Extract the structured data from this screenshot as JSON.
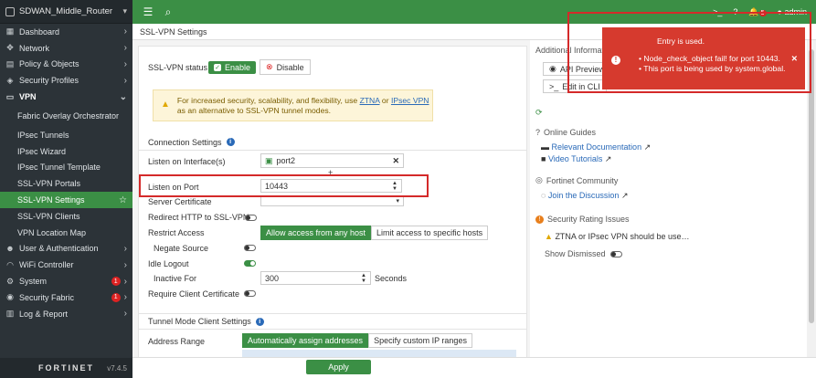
{
  "sidebar": {
    "device_name": "SDWAN_Middle_Router",
    "items": [
      {
        "label": "Dashboard",
        "icon": "dashboard-icon"
      },
      {
        "label": "Network",
        "icon": "network-icon"
      },
      {
        "label": "Policy & Objects",
        "icon": "policy-icon"
      },
      {
        "label": "Security Profiles",
        "icon": "security-profiles-icon"
      },
      {
        "label": "VPN",
        "icon": "vpn-icon"
      },
      {
        "label": "Fabric Overlay Orchestrator"
      },
      {
        "label": "IPsec Tunnels"
      },
      {
        "label": "IPsec Wizard"
      },
      {
        "label": "IPsec Tunnel Template"
      },
      {
        "label": "SSL-VPN Portals"
      },
      {
        "label": "SSL-VPN Settings"
      },
      {
        "label": "SSL-VPN Clients"
      },
      {
        "label": "VPN Location Map"
      },
      {
        "label": "User & Authentication",
        "icon": "user-icon"
      },
      {
        "label": "WiFi Controller",
        "icon": "wifi-icon"
      },
      {
        "label": "System",
        "icon": "gear-icon",
        "badge": "1"
      },
      {
        "label": "Security Fabric",
        "icon": "fabric-icon",
        "badge": "1"
      },
      {
        "label": "Log & Report",
        "icon": "log-icon"
      }
    ],
    "footer_logo": "FORTINET",
    "version": "v7.4.5"
  },
  "topbar": {
    "user": "admin",
    "alert_count": "5"
  },
  "breadcrumb": "SSL-VPN Settings",
  "main": {
    "status_label": "SSL-VPN status",
    "enable_label": "Enable",
    "disable_label": "Disable",
    "warning_pre": "For increased security, scalability, and flexibility, use ",
    "warning_link1": "ZTNA",
    "warning_or": " or ",
    "warning_link2": "IPsec VPN",
    "warning_post": "as an alternative to SSL-VPN tunnel modes.",
    "connection_settings": "Connection Settings",
    "listen_interface_label": "Listen on Interface(s)",
    "listen_interface_value": "port2",
    "listen_port_label": "Listen on Port",
    "listen_port_value": "10443",
    "server_cert_label": "Server Certificate",
    "redirect_label": "Redirect HTTP to SSL-VPN",
    "restrict_label": "Restrict Access",
    "restrict_opt1": "Allow access from any host",
    "restrict_opt2": "Limit access to specific hosts",
    "negate_label": "Negate Source",
    "idle_label": "Idle Logout",
    "inactive_label": "Inactive For",
    "inactive_value": "300",
    "inactive_unit": "Seconds",
    "client_cert_label": "Require Client Certificate",
    "tunnel_settings": "Tunnel Mode Client Settings",
    "address_range_label": "Address Range",
    "address_opt1": "Automatically assign addresses",
    "address_opt2": "Specify custom IP ranges",
    "apply_label": "Apply"
  },
  "right_panel": {
    "title": "Additional Informatio",
    "api_preview": "API Preview",
    "edit_cli": "Edit in CLI",
    "online_guides": "Online Guides",
    "relevant_docs": "Relevant Documentation",
    "video_tutorials": "Video Tutorials",
    "community": "Fortinet Community",
    "join_discussion": "Join the Discussion",
    "rating_issues": "Security Rating Issues",
    "rating_item": "ZTNA or IPsec VPN should be use…",
    "show_dismissed": "Show Dismissed"
  },
  "toast": {
    "title": "Entry is used.",
    "line1": "Node_check_object fail! for port 10443.",
    "line2": "This port is being used by system.global."
  },
  "colors": {
    "accent": "#3b8f45",
    "sidebar": "#2c3338",
    "error": "#d63a2e"
  }
}
